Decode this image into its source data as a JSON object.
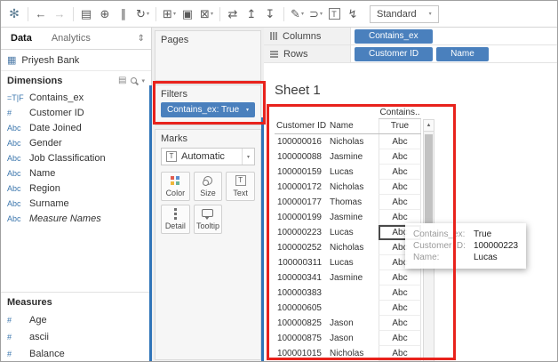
{
  "colors": {
    "pill": "#4a80bd",
    "icon_blue": "#3b76ad",
    "annotation": "#e8221c",
    "splitter": "#2f74b8"
  },
  "toolbar": {
    "icons": [
      {
        "name": "tableau-logo-icon",
        "glyph": "✻",
        "cls": "logo"
      },
      {
        "cls": "sep",
        "glyph": ""
      },
      {
        "name": "undo-icon",
        "glyph": "←"
      },
      {
        "name": "redo-icon",
        "glyph": "→",
        "cls": "dim"
      },
      {
        "cls": "sep",
        "glyph": ""
      },
      {
        "name": "save-icon",
        "glyph": "▤"
      },
      {
        "name": "new-datasource-icon",
        "glyph": "⊕"
      },
      {
        "name": "pause-auto-updates-icon",
        "glyph": "∥"
      },
      {
        "name": "run-auto-updates-icon",
        "glyph": "↻",
        "caret": "▾"
      },
      {
        "cls": "sep",
        "glyph": ""
      },
      {
        "name": "new-worksheet-icon",
        "glyph": "⊞",
        "caret": "▾"
      },
      {
        "name": "duplicate-sheet-icon",
        "glyph": "▣"
      },
      {
        "name": "clear-sheet-icon",
        "glyph": "⊠",
        "caret": "▾"
      },
      {
        "cls": "sep",
        "glyph": ""
      },
      {
        "name": "swap-rows-columns-icon",
        "glyph": "⇄"
      },
      {
        "name": "sort-ascending-icon",
        "glyph": "↥"
      },
      {
        "name": "sort-descending-icon",
        "glyph": "↧"
      },
      {
        "cls": "sep",
        "glyph": ""
      },
      {
        "name": "highlight-icon",
        "glyph": "✎",
        "caret": "▾"
      },
      {
        "name": "group-members-icon",
        "glyph": "⊃",
        "caret": "▾"
      },
      {
        "name": "show-mark-labels-icon",
        "glyph": "T",
        "cls": "boxed"
      },
      {
        "name": "presentation-mode-icon",
        "glyph": "↯"
      }
    ],
    "fit": {
      "label": "Standard",
      "caret": "▾"
    }
  },
  "sidebar": {
    "tabs": [
      {
        "label": "Data",
        "cls": "active"
      },
      {
        "label": "Analytics",
        "cls": ""
      }
    ],
    "tabs_sort_icon": "⇕",
    "datasource": {
      "icon": "▦",
      "name": "Priyesh Bank"
    },
    "dimensions": {
      "title": "Dimensions",
      "view_icon": "▤",
      "caret_icon": "▾",
      "items": [
        {
          "icon": "=T|F",
          "label": "Contains_ex",
          "cls": ""
        },
        {
          "icon": "#",
          "label": "Customer ID",
          "cls": ""
        },
        {
          "icon": "Abc",
          "label": "Date Joined",
          "cls": ""
        },
        {
          "icon": "Abc",
          "label": "Gender",
          "cls": ""
        },
        {
          "icon": "Abc",
          "label": "Job Classification",
          "cls": ""
        },
        {
          "icon": "Abc",
          "label": "Name",
          "cls": ""
        },
        {
          "icon": "Abc",
          "label": "Region",
          "cls": ""
        },
        {
          "icon": "Abc",
          "label": "Surname",
          "cls": ""
        },
        {
          "icon": "Abc",
          "label": "Measure Names",
          "cls": "italic"
        }
      ]
    },
    "measures": {
      "title": "Measures",
      "items": [
        {
          "icon": "#",
          "label": "Age"
        },
        {
          "icon": "#",
          "label": "ascii"
        },
        {
          "icon": "#",
          "label": "Balance"
        }
      ]
    }
  },
  "cards": {
    "pages": {
      "title": "Pages"
    },
    "filters": {
      "title": "Filters",
      "pill": {
        "label": "Contains_ex: True",
        "caret": "▾"
      }
    },
    "marks": {
      "title": "Marks",
      "type": {
        "icon": "T",
        "label": "Automatic",
        "caret": "▾"
      },
      "buttons": [
        {
          "label": "Color"
        },
        {
          "label": "Size"
        },
        {
          "label": "Text",
          "glyph": "T"
        },
        {
          "label": "Detail"
        },
        {
          "label": "Tooltip"
        }
      ]
    }
  },
  "shelves": {
    "columns": {
      "label": "Columns",
      "pills": [
        {
          "label": "Contains_ex"
        }
      ]
    },
    "rows": {
      "label": "Rows",
      "pills": [
        {
          "label": "Customer ID"
        },
        {
          "label": "Name"
        }
      ]
    }
  },
  "sheet": {
    "title": "Sheet 1",
    "table": {
      "field_label": "Contains..",
      "headers": {
        "id": "Customer ID",
        "name": "Name",
        "value": "True"
      },
      "scroll_up_icon": "▲",
      "rows": [
        {
          "id": "100000016",
          "name": "Nicholas",
          "val": "Abc",
          "cls": ""
        },
        {
          "id": "100000088",
          "name": "Jasmine",
          "val": "Abc",
          "cls": ""
        },
        {
          "id": "100000159",
          "name": "Lucas",
          "val": "Abc",
          "cls": ""
        },
        {
          "id": "100000172",
          "name": "Nicholas",
          "val": "Abc",
          "cls": ""
        },
        {
          "id": "100000177",
          "name": "Thomas",
          "val": "Abc",
          "cls": ""
        },
        {
          "id": "100000199",
          "name": "Jasmine",
          "val": "Abc",
          "cls": ""
        },
        {
          "id": "100000223",
          "name": "Lucas",
          "val": "Abc",
          "cls": "selected"
        },
        {
          "id": "100000252",
          "name": "Nicholas",
          "val": "Abc",
          "cls": ""
        },
        {
          "id": "100000311",
          "name": "Lucas",
          "val": "Abc",
          "cls": ""
        },
        {
          "id": "100000341",
          "name": "Jasmine",
          "val": "Abc",
          "cls": ""
        },
        {
          "id": "100000383",
          "name": "",
          "val": "Abc",
          "cls": ""
        },
        {
          "id": "100000605",
          "name": "",
          "val": "Abc",
          "cls": ""
        },
        {
          "id": "100000825",
          "name": "Jason",
          "val": "Abc",
          "cls": ""
        },
        {
          "id": "100000875",
          "name": "Jason",
          "val": "Abc",
          "cls": ""
        },
        {
          "id": "100001015",
          "name": "Nicholas",
          "val": "Abc",
          "cls": ""
        }
      ]
    },
    "tooltip": {
      "rows": [
        {
          "label": "Contains_ex:",
          "value": "True"
        },
        {
          "label": "Customer ID:",
          "value": "100000223"
        },
        {
          "label": "Name:",
          "value": "Lucas"
        }
      ]
    }
  }
}
